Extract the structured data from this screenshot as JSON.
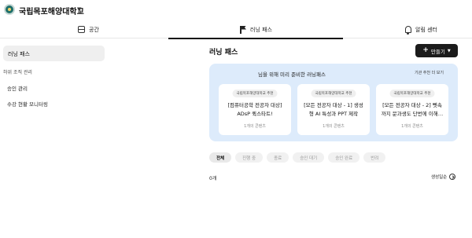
{
  "header": {
    "school_name": "국립목포해양대학교",
    "logo_icon": "university-emblem-icon",
    "dropdown_icon": "caret-down-icon"
  },
  "tabs": [
    {
      "label": "공간",
      "icon": "layout-icon",
      "active": false
    },
    {
      "label": "러닝 패스",
      "icon": "flag-icon",
      "active": true
    },
    {
      "label": "알림 센터",
      "icon": "bell-icon",
      "active": false
    }
  ],
  "sidebar": {
    "active_item": "러닝 패스",
    "section_label": "하위 조직 관리",
    "items": [
      "승인 관리",
      "수강 현황 모니터링"
    ]
  },
  "main": {
    "title": "러닝 패스",
    "create_button": "만들기",
    "promo": {
      "title": "님을 위해 미리 준비한 러닝패스",
      "link": "기관 추천 더 보기",
      "bg_color": "#ddebfb",
      "cards": [
        {
          "badge": "국립목포해양대학교 추천",
          "title": "[컴퓨터공학 전공자 대상] ADsP 퀵스타트!",
          "count": "1개의 콘텐츠"
        },
        {
          "badge": "국립목포해양대학교 추천",
          "title": "[모든 전공자 대상 - 1] 생성형 AI 특성과 PPT 제작",
          "count": "1개의 콘텐츠"
        },
        {
          "badge": "국립목포해양대학교 추천",
          "title": "[모든 전공자 대상 - 2] 뼛속까지 문과생도 단번에 이해…",
          "count": "1개의 콘텐츠"
        }
      ]
    },
    "filters": [
      "전체",
      "진행 중",
      "종료",
      "승인 대기",
      "승인 완료",
      "반려"
    ],
    "active_filter": "전체",
    "result_count": "0개",
    "sort_label": "생성일순"
  }
}
